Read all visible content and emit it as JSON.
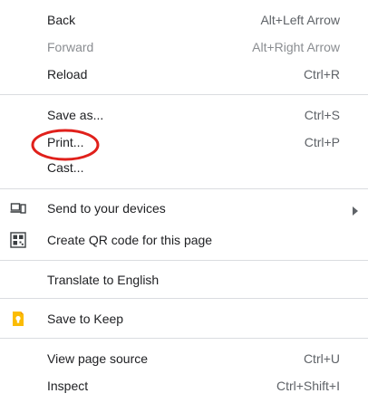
{
  "menu": {
    "back": {
      "label": "Back",
      "shortcut": "Alt+Left Arrow"
    },
    "forward": {
      "label": "Forward",
      "shortcut": "Alt+Right Arrow"
    },
    "reload": {
      "label": "Reload",
      "shortcut": "Ctrl+R"
    },
    "save_as": {
      "label": "Save as...",
      "shortcut": "Ctrl+S"
    },
    "print": {
      "label": "Print...",
      "shortcut": "Ctrl+P"
    },
    "cast": {
      "label": "Cast..."
    },
    "send_devices": {
      "label": "Send to your devices",
      "icon": "devices-icon"
    },
    "qr_code": {
      "label": "Create QR code for this page",
      "icon": "qr-code-icon"
    },
    "translate": {
      "label": "Translate to English"
    },
    "save_keep": {
      "label": "Save to Keep",
      "icon": "google-keep-icon"
    },
    "view_source": {
      "label": "View page source",
      "shortcut": "Ctrl+U"
    },
    "inspect": {
      "label": "Inspect",
      "shortcut": "Ctrl+Shift+I"
    }
  },
  "colors": {
    "text": "#202124",
    "shortcut_text": "#5f6368",
    "disabled_text": "#8a8d91",
    "separator": "#dadce0",
    "annotation_red": "#e0201b",
    "keep_yellow": "#fbbc04"
  }
}
